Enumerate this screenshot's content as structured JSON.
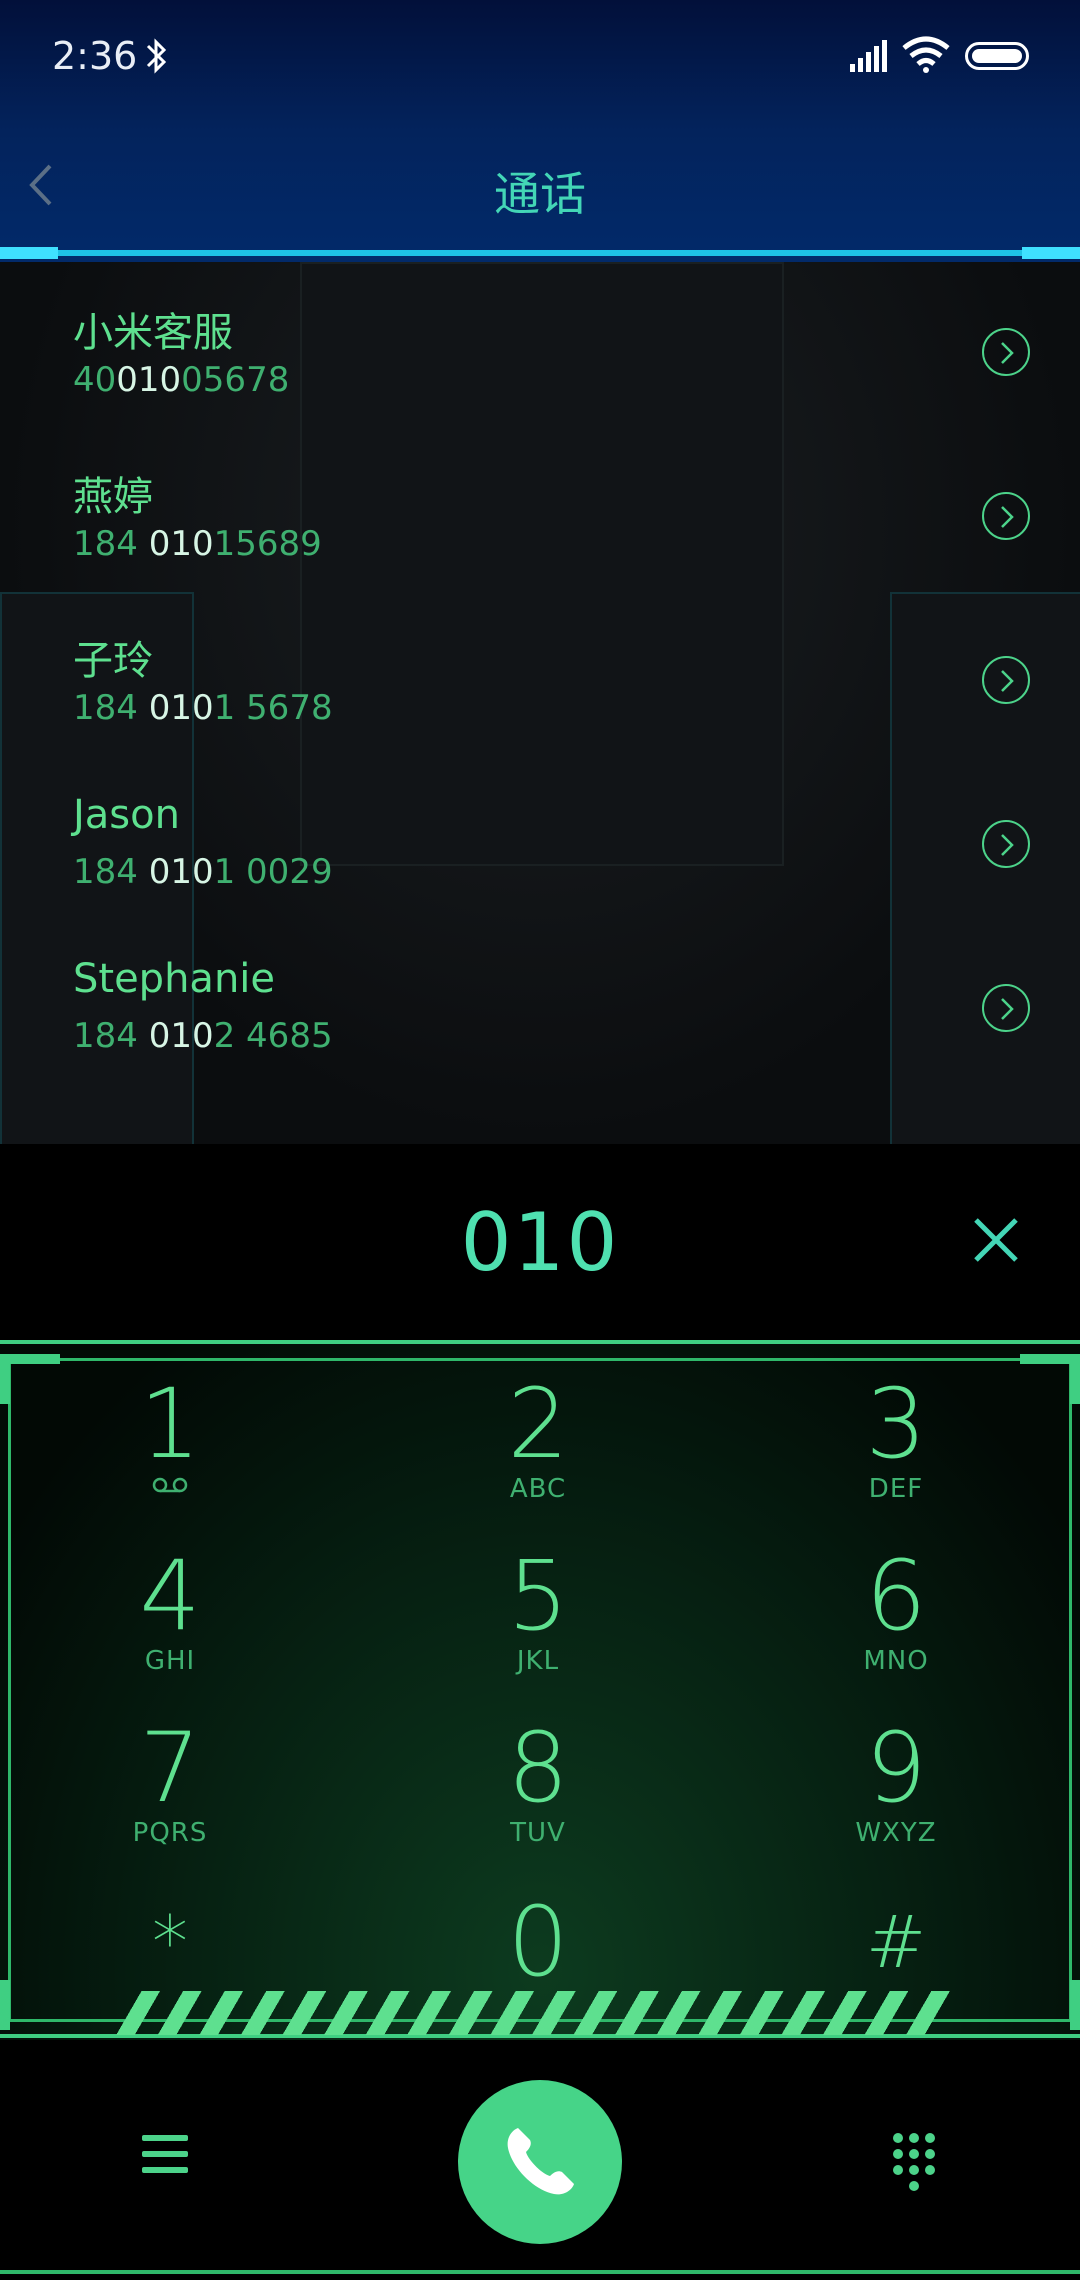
{
  "status": {
    "time": "2:36"
  },
  "header": {
    "title": "通话"
  },
  "contacts": [
    {
      "name": "小米客服",
      "pre": "40",
      "hl": "010",
      "mid": "",
      "hl2": "",
      "post": "05678",
      "num_full": "40010 05678"
    },
    {
      "name": "燕婷",
      "pre": "184 ",
      "hl": "010",
      "post": "15689"
    },
    {
      "name": "子玲",
      "pre": "184 ",
      "hl": "010",
      "post": "1 5678"
    },
    {
      "name": "Jason",
      "pre": "184 ",
      "hl": "010",
      "post": "1 0029"
    },
    {
      "name": "Stephanie",
      "pre": "184 ",
      "hl": "010",
      "post": "2 4685"
    }
  ],
  "input": {
    "digits": "010"
  },
  "keypad": [
    {
      "num": "1",
      "sub": "voicemail"
    },
    {
      "num": "2",
      "sub": "ABC"
    },
    {
      "num": "3",
      "sub": "DEF"
    },
    {
      "num": "4",
      "sub": "GHI"
    },
    {
      "num": "5",
      "sub": "JKL"
    },
    {
      "num": "6",
      "sub": "MNO"
    },
    {
      "num": "7",
      "sub": "PQRS"
    },
    {
      "num": "8",
      "sub": "TUV"
    },
    {
      "num": "9",
      "sub": "WXYZ"
    },
    {
      "num": "*",
      "sub": ""
    },
    {
      "num": "0",
      "sub": "+"
    },
    {
      "num": "#",
      "sub": ""
    }
  ],
  "colors": {
    "accent": "#5ee08f",
    "header_bg": "#03235c",
    "call_button": "#46d488"
  }
}
